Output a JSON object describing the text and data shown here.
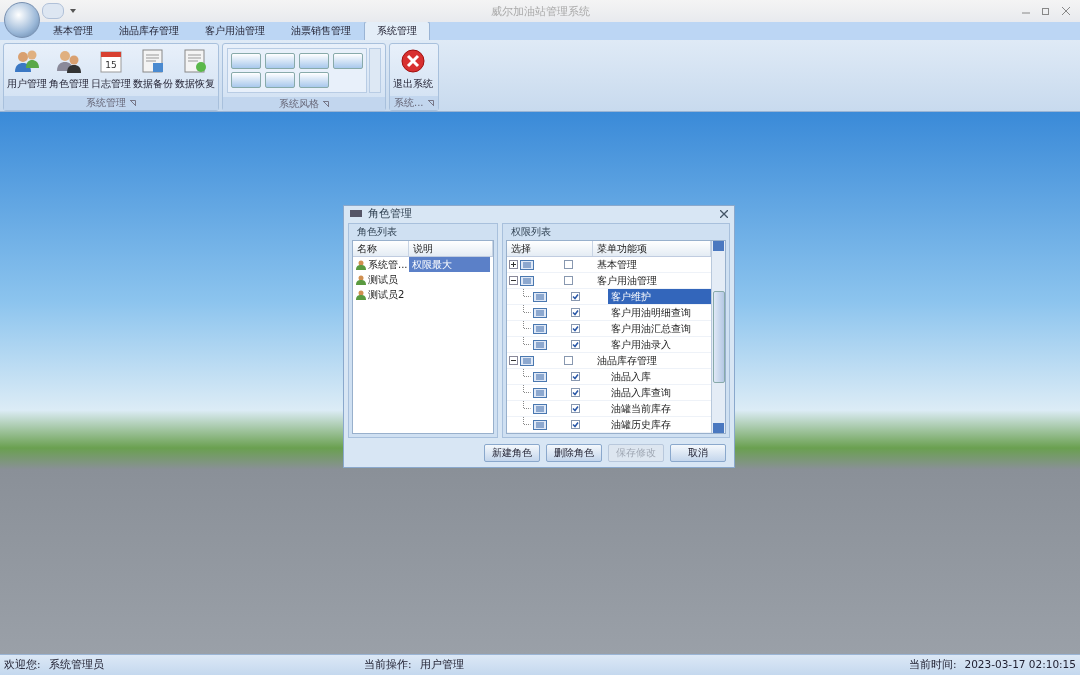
{
  "window": {
    "title": "威尔加油站管理系统"
  },
  "ribbon_tabs": [
    {
      "label": "基本管理",
      "selected": false
    },
    {
      "label": "油品库存管理",
      "selected": false
    },
    {
      "label": "客户用油管理",
      "selected": false
    },
    {
      "label": "油票销售管理",
      "selected": false
    },
    {
      "label": "系统管理",
      "selected": true
    }
  ],
  "ribbon_groups": [
    {
      "kind": "buttons",
      "label": "系统管理",
      "buttons": [
        {
          "label": "用户管理",
          "kind": "users"
        },
        {
          "label": "角色管理",
          "kind": "role"
        },
        {
          "label": "日志管理",
          "kind": "calendar",
          "icon_text": "15"
        },
        {
          "label": "数据备份",
          "kind": "backup"
        },
        {
          "label": "数据恢复",
          "kind": "restore"
        }
      ]
    },
    {
      "kind": "gallery",
      "label": "系统风格"
    },
    {
      "kind": "buttons",
      "label": "系统...",
      "buttons": [
        {
          "label": "退出系统",
          "kind": "exit"
        }
      ]
    }
  ],
  "dialog": {
    "title": "角色管理",
    "roles_panel": {
      "title": "角色列表",
      "columns": [
        "名称",
        "说明"
      ],
      "rows": [
        {
          "name": "系统管...",
          "description": "权限最大",
          "selected": true
        },
        {
          "name": "测试员",
          "selected": false
        },
        {
          "name": "测试员2",
          "selected": false
        }
      ]
    },
    "permissions_panel": {
      "title": "权限列表",
      "columns": [
        "选择",
        "菜单功能项"
      ],
      "tree": [
        {
          "label": "基本管理",
          "checked": false,
          "expanded": false,
          "selected": false
        },
        {
          "label": "客户用油管理",
          "checked": false,
          "expanded": true,
          "selected": false,
          "children": [
            {
              "label": "客户维护",
              "checked": true,
              "selected": true
            },
            {
              "label": "客户用油明细查询",
              "checked": true,
              "selected": false
            },
            {
              "label": "客户用油汇总查询",
              "checked": true,
              "selected": false
            },
            {
              "label": "客户用油录入",
              "checked": true,
              "selected": false
            }
          ]
        },
        {
          "label": "油品库存管理",
          "checked": false,
          "expanded": true,
          "selected": false,
          "children": [
            {
              "label": "油品入库",
              "checked": true,
              "selected": false
            },
            {
              "label": "油品入库查询",
              "checked": true,
              "selected": false
            },
            {
              "label": "油罐当前库存",
              "checked": true,
              "selected": false
            },
            {
              "label": "油罐历史库存",
              "checked": true,
              "selected": false
            }
          ]
        }
      ]
    },
    "buttons": [
      {
        "label": "新建角色",
        "disabled": false
      },
      {
        "label": "删除角色",
        "disabled": false
      },
      {
        "label": "保存修改",
        "disabled": true
      },
      {
        "label": "取消",
        "disabled": false
      }
    ]
  },
  "status_bar": {
    "user_label": "欢迎您:",
    "user": "系统管理员",
    "operation_label": "当前操作:",
    "operation": "用户管理",
    "time_label": "当前时间:",
    "time": "2023-03-17 02:10:15"
  }
}
